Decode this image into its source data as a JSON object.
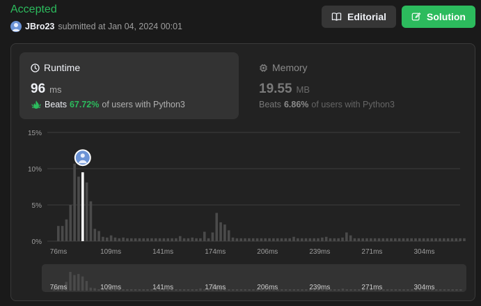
{
  "header": {
    "status": "Accepted",
    "username": "JBro23",
    "submitted_text": "submitted at Jan 04, 2024 00:01",
    "editorial_label": "Editorial",
    "solution_label": "Solution"
  },
  "runtime": {
    "title": "Runtime",
    "value": "96",
    "unit": "ms",
    "beats_label": "Beats",
    "beats_pct": "67.72%",
    "beats_suffix": "of users with Python3"
  },
  "memory": {
    "title": "Memory",
    "value": "19.55",
    "unit": "MB",
    "beats_label": "Beats",
    "beats_pct": "6.86%",
    "beats_suffix": "of users with Python3"
  },
  "colors": {
    "accent_green": "#2cbb5d",
    "bar": "#4a4a4a",
    "highlight_bar": "#ffffff"
  },
  "chart_data": {
    "type": "bar",
    "ylim": [
      0,
      15
    ],
    "y_ticks": [
      "0%",
      "5%",
      "10%",
      "15%"
    ],
    "x_ticks": [
      "76ms",
      "109ms",
      "141ms",
      "174ms",
      "206ms",
      "239ms",
      "271ms",
      "304ms"
    ],
    "values": [
      2.1,
      2.1,
      3.0,
      5.0,
      10.7,
      8.9,
      9.5,
      8.1,
      5.5,
      1.7,
      1.4,
      0.6,
      0.5,
      0.8,
      0.5,
      0.4,
      0.5,
      0.4,
      0.4,
      0.4,
      0.4,
      0.4,
      0.4,
      0.4,
      0.4,
      0.4,
      0.4,
      0.4,
      0.4,
      0.4,
      0.7,
      0.4,
      0.4,
      0.5,
      0.4,
      0.4,
      1.3,
      0.4,
      1.2,
      3.9,
      2.6,
      2.3,
      1.5,
      0.5,
      0.4,
      0.4,
      0.4,
      0.4,
      0.4,
      0.4,
      0.4,
      0.4,
      0.4,
      0.4,
      0.4,
      0.4,
      0.4,
      0.4,
      0.6,
      0.4,
      0.4,
      0.4,
      0.4,
      0.4,
      0.4,
      0.5,
      0.6,
      0.4,
      0.4,
      0.4,
      0.5,
      1.2,
      0.8,
      0.4,
      0.4,
      0.4,
      0.4,
      0.4,
      0.4,
      0.4,
      0.4,
      0.4,
      0.4,
      0.4,
      0.4,
      0.4,
      0.4,
      0.4,
      0.4,
      0.4,
      0.4,
      0.4,
      0.4,
      0.4,
      0.4,
      0.4,
      0.4,
      0.4,
      0.4,
      0.4,
      0.4
    ],
    "highlight_index": 6,
    "grid": true
  }
}
